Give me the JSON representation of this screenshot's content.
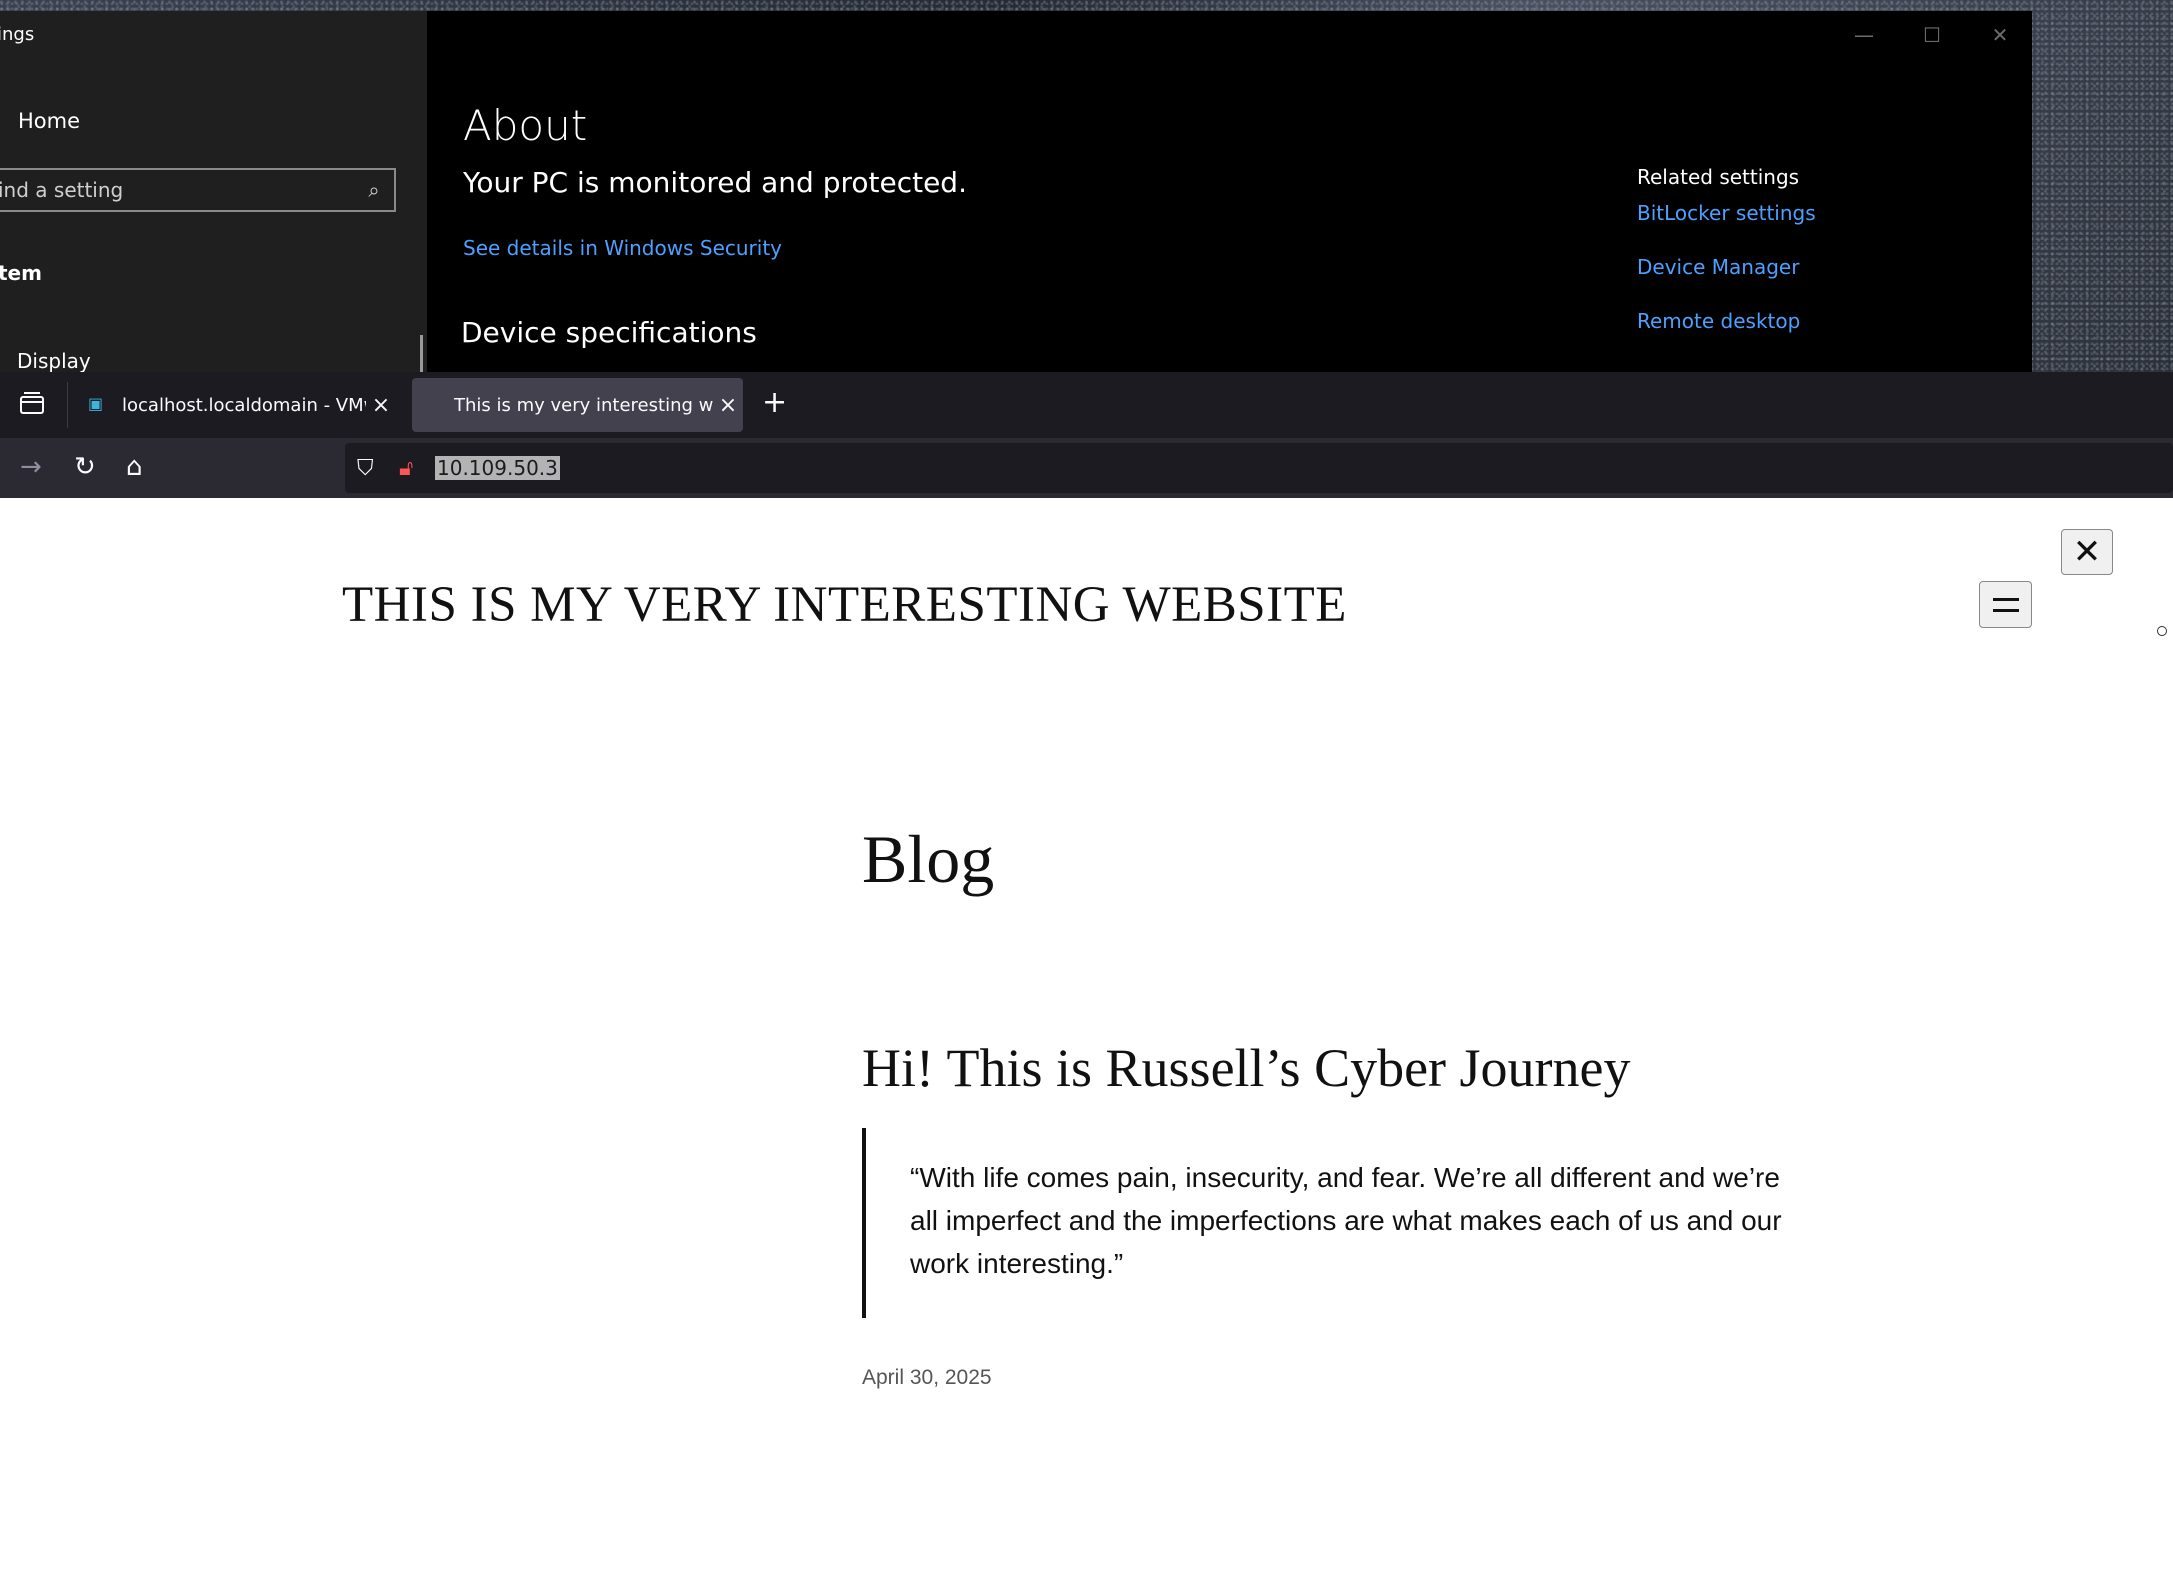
{
  "settings_window": {
    "title": "ings",
    "sidebar": {
      "home_label": "Home",
      "search_placeholder": "ind a setting",
      "section_label": "tem",
      "display_label": "Display"
    },
    "main": {
      "heading": "About",
      "status": "Your PC is monitored and protected.",
      "security_link": "See details in Windows Security",
      "device_spec_heading": "Device specifications",
      "related": {
        "header": "Related settings",
        "links": [
          "BitLocker settings",
          "Device Manager",
          "Remote desktop"
        ]
      }
    }
  },
  "browser": {
    "tabs": [
      {
        "title": "localhost.localdomain - VMware",
        "active": false
      },
      {
        "title": "This is my very interesting website",
        "active": true
      }
    ],
    "address": "10.109.50.3"
  },
  "page": {
    "site_title": "THIS IS MY VERY INTERESTING WEBSITE",
    "blog_heading": "Blog",
    "post_title": "Hi! This is Russell’s Cyber Journey",
    "quote": "“With life comes pain, insecurity, and fear. We’re all different and we’re all imperfect and the imperfections are what makes each of us and our work interesting.”",
    "date": "April 30, 2025"
  },
  "colors": {
    "link_blue": "#4ca0ff",
    "browser_chrome": "#1c1b22",
    "active_tab": "#42414d"
  },
  "icons": {
    "close_dialog": "close-icon",
    "menu": "hamburger-icon"
  }
}
